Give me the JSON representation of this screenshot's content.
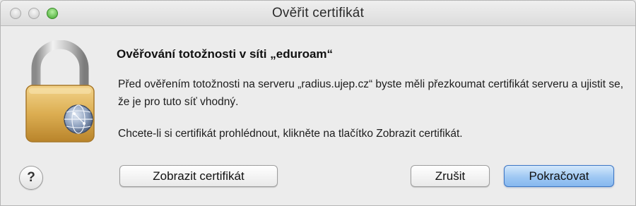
{
  "window": {
    "title": "Ověřit certifikát"
  },
  "dialog": {
    "heading": "Ověřování totožnosti v síti „eduroam“",
    "message": "Před ověřením totožnosti na serveru „radius.ujep.cz“ byste měli přezkoumat certifikát serveru a ujistit se, že je pro tuto síť vhodný.",
    "instruction": "Chcete-li si certifikát prohlédnout, klikněte na tlačítko Zobrazit certifikát.",
    "icon": "lock-with-network-globe-icon"
  },
  "buttons": {
    "help": "?",
    "show_certificate": "Zobrazit certifikát",
    "cancel": "Zrušit",
    "continue": "Pokračovat"
  },
  "colors": {
    "default_button": "#9fc8f3",
    "window_background": "#ececec"
  }
}
